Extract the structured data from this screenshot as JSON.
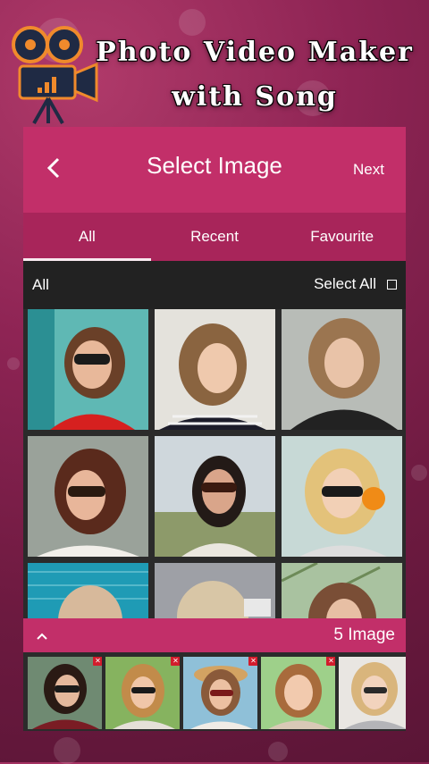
{
  "promo": {
    "title_line1": "Photo Video Maker",
    "title_line2": "with Song",
    "logo_icon": "movie-camera-icon"
  },
  "header": {
    "back_icon": "chevron-left-icon",
    "title": "Select Image",
    "next_label": "Next"
  },
  "tabs": [
    {
      "label": "All",
      "active": true
    },
    {
      "label": "Recent",
      "active": false
    },
    {
      "label": "Favourite",
      "active": false
    }
  ],
  "subbar": {
    "folder_label": "All",
    "select_all_label": "Select All",
    "select_all_checked": false
  },
  "gallery": {
    "items": [
      {
        "name": "photo-woman-red-top"
      },
      {
        "name": "photo-woman-striped-shirt"
      },
      {
        "name": "photo-woman-leather-jacket"
      },
      {
        "name": "photo-woman-sunglasses-dark-hair"
      },
      {
        "name": "photo-woman-halter-top"
      },
      {
        "name": "photo-woman-headphones"
      },
      {
        "name": "photo-woman-teal-wall"
      },
      {
        "name": "photo-woman-grey-background"
      },
      {
        "name": "photo-woman-trees"
      }
    ]
  },
  "selection": {
    "collapse_icon": "chevron-up-icon",
    "count_label": "5 Image",
    "remove_icon": "close-icon",
    "selected": [
      {
        "name": "selected-photo-1"
      },
      {
        "name": "selected-photo-2"
      },
      {
        "name": "selected-photo-3"
      },
      {
        "name": "selected-photo-4"
      },
      {
        "name": "selected-photo-5"
      }
    ]
  },
  "colors": {
    "accent": "#c22f69",
    "tab_bar": "#a8255a",
    "panel": "#2b2b2b",
    "remove_badge": "#d21c2c"
  }
}
